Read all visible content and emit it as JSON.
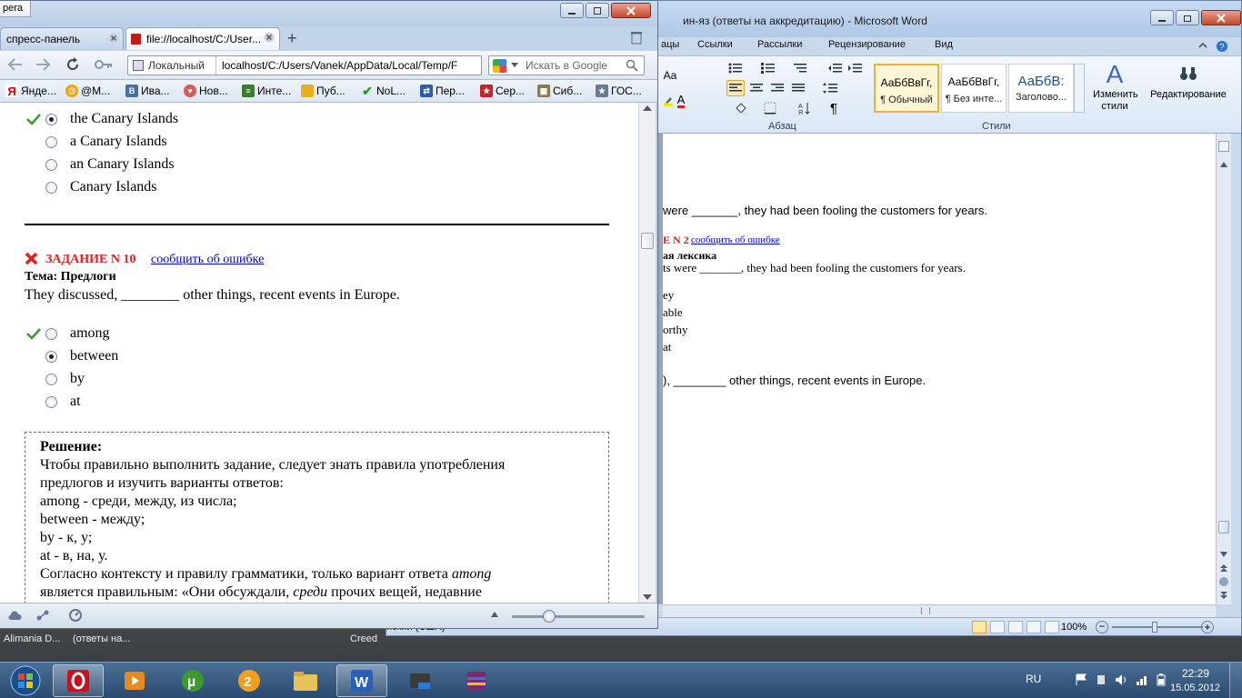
{
  "opera": {
    "title_fragment": "pera",
    "tabs": [
      {
        "label": "спресс-панель"
      },
      {
        "label": "file://localhost/C:/User..."
      }
    ],
    "address_prefix": "Локальный",
    "address": "localhost/C:/Users/Vanek/AppData/Local/Temp/F",
    "search_placeholder": "Искать в Google",
    "bookmarks": [
      "Янде...",
      "@M...",
      "Ива...",
      "Нов...",
      "Инте...",
      "Пуб...",
      "NoL...",
      "Пер...",
      "Сер...",
      "Сиб...",
      "ГОС..."
    ]
  },
  "page": {
    "q9_options": [
      {
        "text": "the Canary Islands",
        "checked": true,
        "correct": true
      },
      {
        "text": "a Canary Islands",
        "checked": false,
        "correct": false
      },
      {
        "text": "an Canary Islands",
        "checked": false,
        "correct": false
      },
      {
        "text": "Canary Islands",
        "checked": false,
        "correct": false
      }
    ],
    "task_title": "ЗАДАНИЕ N 10",
    "report_link": "сообщить об ошибке",
    "topic": "Тема: Предлоги",
    "question": "They discussed, ________ other things, recent events in Europe.",
    "q10_options": [
      {
        "text": "among",
        "checked": false,
        "correct": true
      },
      {
        "text": "between",
        "checked": true,
        "correct": false
      },
      {
        "text": "by",
        "checked": false,
        "correct": false
      },
      {
        "text": "at",
        "checked": false,
        "correct": false
      }
    ],
    "solution": {
      "heading": "Решение:",
      "lines": [
        "Чтобы правильно выполнить задание, следует знать правила употребления",
        "предлогов и изучить варианты ответов:",
        "among - среди, между, из числа;",
        "between - между;",
        "by - к, у;",
        "at - в, на, у."
      ],
      "line7_a": "Согласно контексту и правилу грамматики, только вариант ответа ",
      "line7_em": "among",
      "line8_a": "является правильным: «Они обсуждали, ",
      "line8_em": "среди",
      "line8_b": " прочих вещей, недавние"
    }
  },
  "word": {
    "title": "ин-яз (ответы на аккредитацию)  -  Microsoft Word",
    "tabs": [
      "ацы",
      "Ссылки",
      "Рассылки",
      "Рецензирование",
      "Вид"
    ],
    "group_paragraph": "Абзац",
    "group_styles": "Стили",
    "styles": [
      {
        "sample": "АаБбВвГг,",
        "name": "¶ Обычный"
      },
      {
        "sample": "АаБбВвГг,",
        "name": "¶ Без инте..."
      },
      {
        "sample": "АаБбВ:",
        "name": "Заголово..."
      }
    ],
    "change_styles": "Изменить стили",
    "editing": "Редактирование",
    "doc_lines": {
      "l1": "were _______, they had been fooling the customers for years.",
      "l2_task": "E N 2",
      "l2_link": "сообщить об ошибке",
      "l3": "ая лексика",
      "l4": "ts were _______, they had been fooling the customers for years.",
      "l5": "ey",
      "l6": "able",
      "l7": "orthy",
      "l8": "at",
      "l9": "), ________ other things, recent events in Europe."
    },
    "status_lang": "йский (США)",
    "zoom": "100%"
  },
  "taskbar": {
    "thumbs": [
      "Alimania D...",
      "(ответы на...",
      "Creed"
    ],
    "lang": "RU",
    "time": "22:29",
    "date": "15.05.2012"
  },
  "colors": {
    "red": "#e0201c",
    "link": "#0000cc",
    "green": "#3a9a2a"
  }
}
